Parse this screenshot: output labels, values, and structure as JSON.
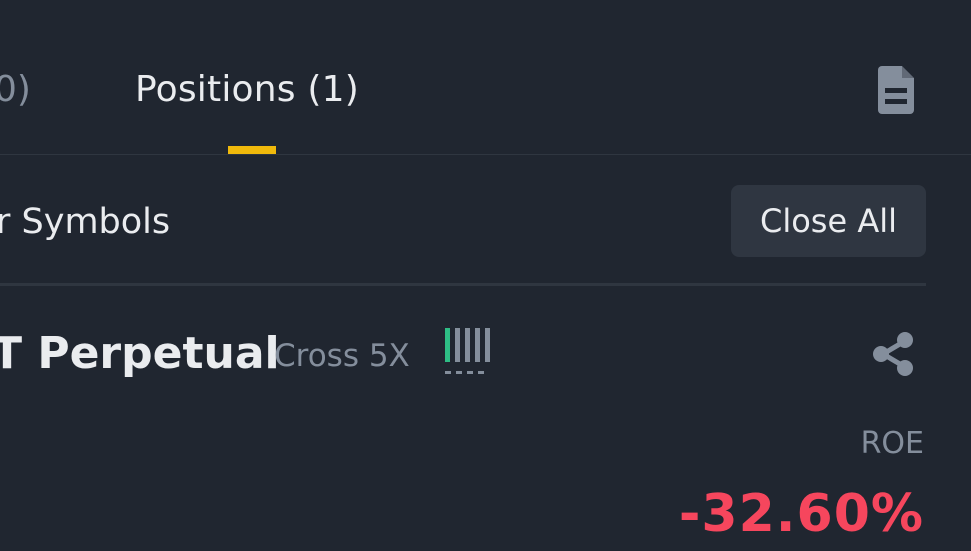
{
  "tabs": {
    "previous_tab_partial": "0)",
    "active_label": "Positions (1)"
  },
  "icons": {
    "order_history": "document-icon",
    "share": "share-icon"
  },
  "filter": {
    "label_partial": "r Symbols"
  },
  "actions": {
    "close_all_label": "Close All"
  },
  "position": {
    "symbol_partial": "T Perpetual",
    "margin_mode": "Cross 5X",
    "adl_level": 1,
    "adl_max": 5,
    "roe_label": "ROE",
    "roe_value": "-32.60%"
  },
  "colors": {
    "background": "#202630",
    "accent": "#f0b90b",
    "text_primary": "#eaecef",
    "text_secondary": "#848e9c",
    "negative": "#f6465d",
    "positive": "#2ebd85"
  }
}
